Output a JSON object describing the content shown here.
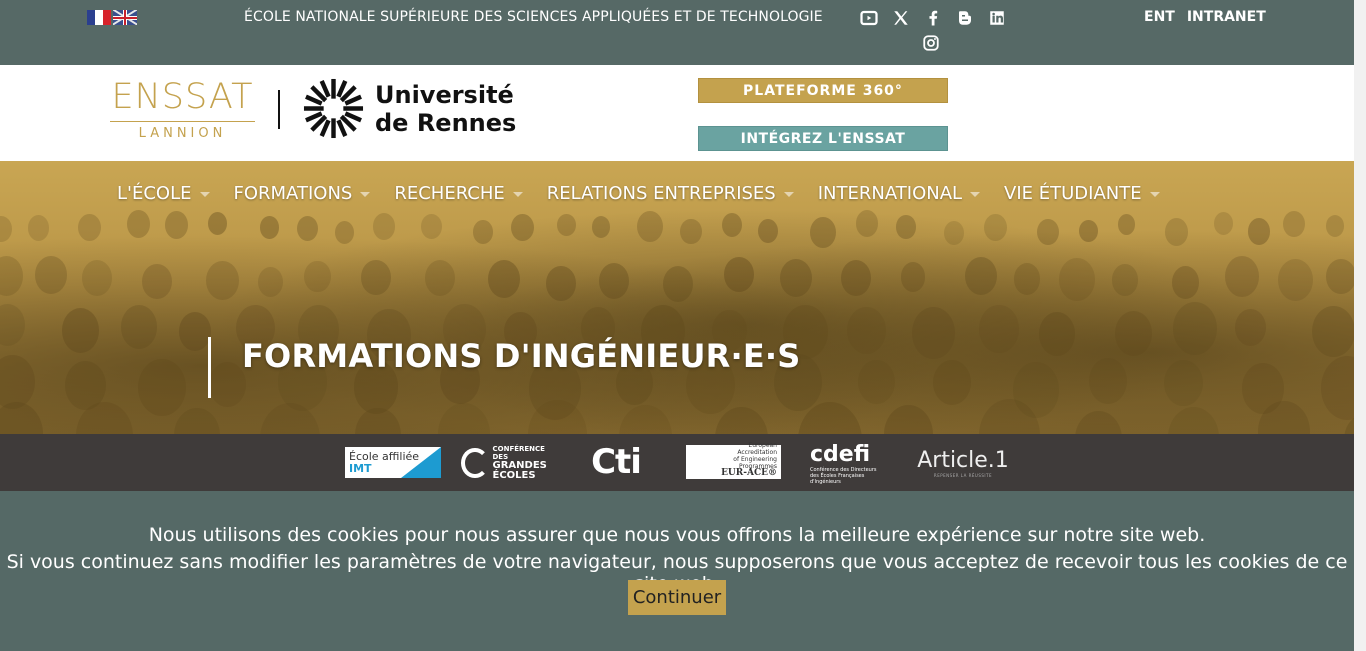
{
  "topbar": {
    "school_name": "ÉCOLE NATIONALE SUPÉRIEURE DES SCIENCES APPLIQUÉES ET DE TECHNOLOGIE",
    "languages": [
      "fr-flag",
      "uk-flag"
    ],
    "socials": [
      "youtube-icon",
      "x-icon",
      "facebook-icon",
      "blogger-icon",
      "linkedin-icon",
      "instagram-icon"
    ],
    "links": {
      "ent": "ENT",
      "intranet": "INTRANET"
    }
  },
  "header": {
    "enssat_logo": {
      "name": "ENSSAT",
      "city": "LANNION"
    },
    "univ_logo": {
      "line1": "Université",
      "line2": "de Rennes"
    },
    "platform_button": "PLATEFORME 360°",
    "integrez_button": "INTÉGREZ L'ENSSAT"
  },
  "nav": {
    "items": [
      {
        "label": "L'ÉCOLE"
      },
      {
        "label": "FORMATIONS"
      },
      {
        "label": "RECHERCHE"
      },
      {
        "label": "RELATIONS ENTREPRISES"
      },
      {
        "label": "INTERNATIONAL"
      },
      {
        "label": "VIE ÉTUDIANTE"
      }
    ]
  },
  "hero": {
    "title": "FORMATIONS D'INGÉNIEUR·E·S"
  },
  "partners": {
    "imt": {
      "line1": "École affiliée",
      "line2": "IMT"
    },
    "cge": {
      "small": "CONFÉRENCE DES",
      "line1": "GRANDES",
      "line2": "ÉCOLES"
    },
    "cti": "Cti",
    "eur": {
      "small1": "European",
      "small2": "Accreditation",
      "small3": "of Engineering",
      "small4": "Programmes",
      "name": "EUR-ACE®"
    },
    "cdefi": {
      "name": "cdefi",
      "sub": "Conférence des Directeurs des Écoles Françaises d'Ingénieurs"
    },
    "article1": {
      "name": "Article.1",
      "sub": "REPENSER LA RÉUSSITE"
    }
  },
  "cookie": {
    "line1": "Nous utilisons des cookies pour nous assurer que nous vous offrons la meilleure expérience sur notre site web.",
    "line2": "Si vous continuez sans modifier les paramètres de votre navigateur, nous supposerons que vous acceptez de recevoir tous les cookies de ce site web.",
    "button": "Continuer"
  },
  "colors": {
    "topbar": "#566966",
    "gold": "#c4a24e",
    "teal": "#6aa3a1",
    "partners_band": "#3f3b3a"
  }
}
